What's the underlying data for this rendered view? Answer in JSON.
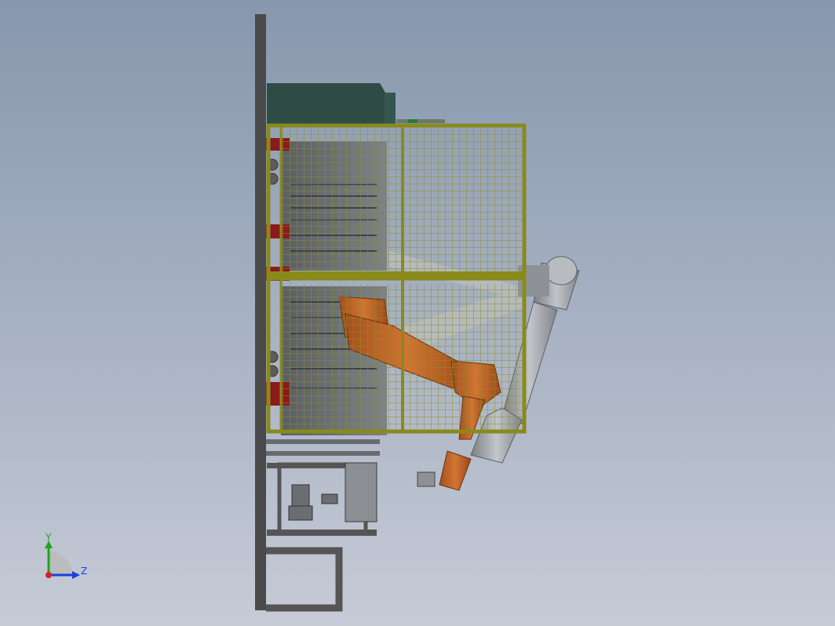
{
  "colors": {
    "background_top": "#8797ad",
    "background_bottom": "#c6cbd6",
    "frame": "#4d4d4d",
    "fence": "#8a8a1c",
    "robot_orange": "#c0642a",
    "robot_grey": "#9a9ea4",
    "cabinet_green": "#2e4a44",
    "accent_red": "#8b1a1a"
  },
  "triad": {
    "y_label": "Y",
    "z_label": "Z",
    "y_color": "#1fa31f",
    "z_color": "#1f3fd6",
    "x_color": "#d42020"
  }
}
